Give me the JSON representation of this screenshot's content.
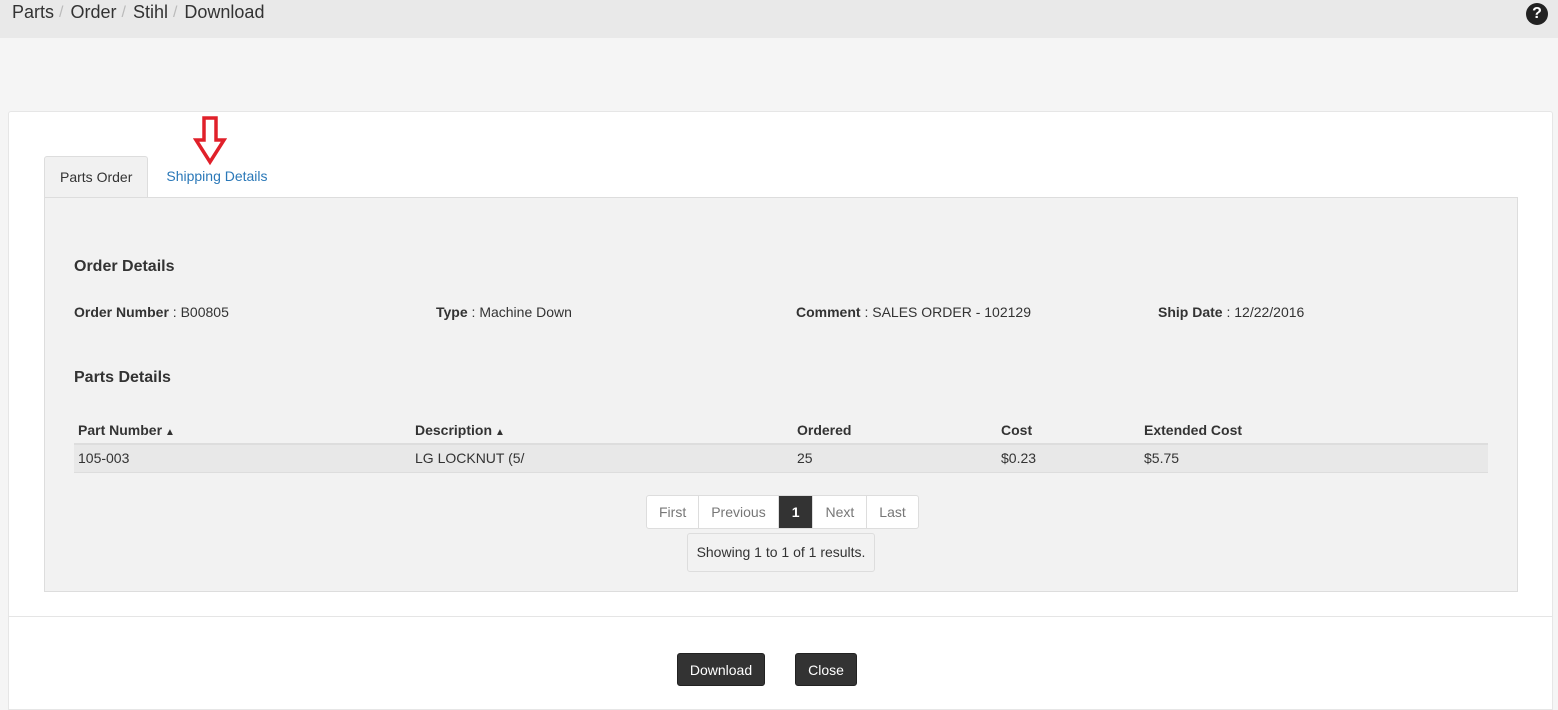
{
  "breadcrumb": {
    "items": [
      "Parts",
      "Order",
      "Stihl",
      "Download"
    ],
    "separator": "/"
  },
  "help_icon": "question-circle-icon",
  "tabs": [
    {
      "label": "Parts Order",
      "active": true
    },
    {
      "label": "Shipping Details",
      "active": false
    }
  ],
  "annotation_arrow_color": "#e0202a",
  "order_details": {
    "title": "Order Details",
    "order_number_label": "Order Number",
    "order_number": "B00805",
    "type_label": "Type",
    "type": "Machine Down",
    "comment_label": "Comment",
    "comment": "SALES ORDER - 102129",
    "ship_date_label": "Ship Date",
    "ship_date": "12/22/2016"
  },
  "parts_details": {
    "title": "Parts Details",
    "columns": [
      "Part Number",
      "Description",
      "Ordered",
      "Cost",
      "Extended Cost"
    ],
    "rows": [
      [
        "105-003",
        "LG LOCKNUT (5/",
        "25",
        "$0.23",
        "$5.75"
      ]
    ]
  },
  "pagination": {
    "first": "First",
    "previous": "Previous",
    "current": "1",
    "next": "Next",
    "last": "Last",
    "summary": "Showing 1 to 1 of 1 results."
  },
  "actions": {
    "download": "Download",
    "close": "Close"
  }
}
